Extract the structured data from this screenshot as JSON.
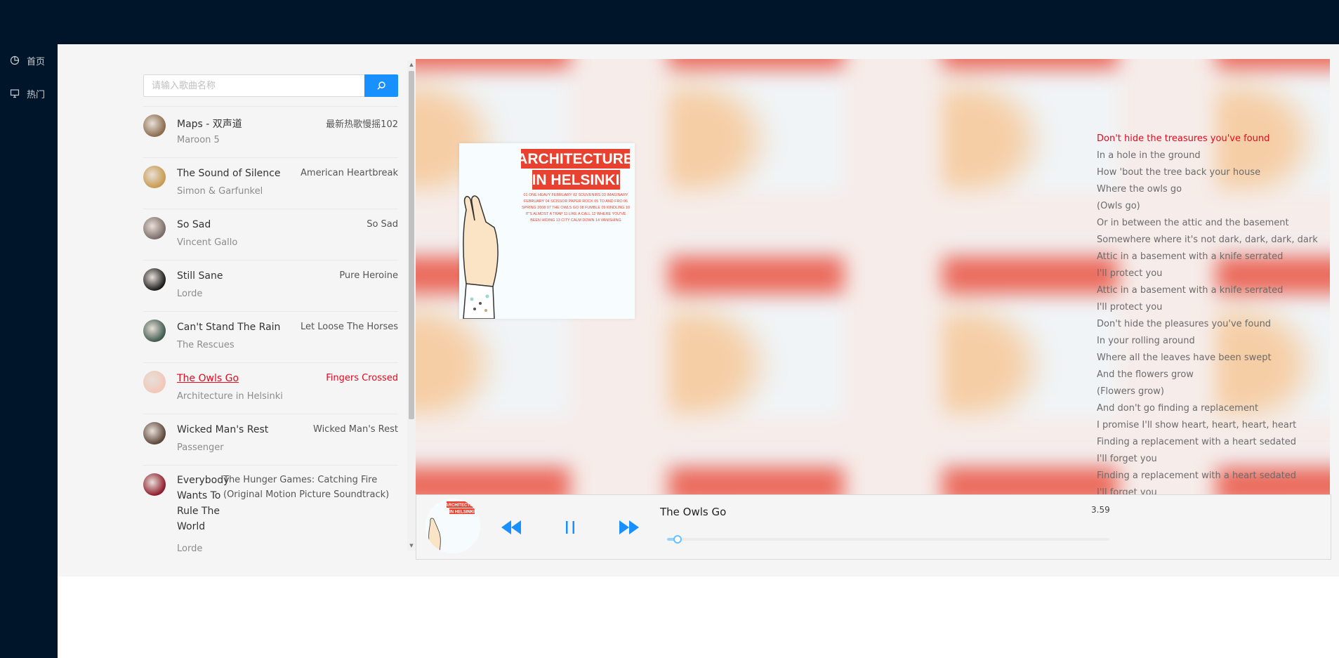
{
  "nav": {
    "home_label": "首页",
    "hot_label": "热门"
  },
  "search": {
    "placeholder": "请输入歌曲名称",
    "value": ""
  },
  "songs": [
    {
      "title": "Maps - 双声道",
      "artist": "Maroon 5",
      "album": "最新热歌慢摇102",
      "avatar_color": "#8a6a4a"
    },
    {
      "title": "The Sound of Silence",
      "artist": "Simon & Garfunkel",
      "album": "American Heartbreak",
      "avatar_color": "#c89a4c"
    },
    {
      "title": "So Sad",
      "artist": "Vincent Gallo",
      "album": "So Sad",
      "avatar_color": "#7a6b66"
    },
    {
      "title": "Still Sane",
      "artist": "Lorde",
      "album": "Pure Heroine",
      "avatar_color": "#1a1a1a"
    },
    {
      "title": "Can't Stand The Rain",
      "artist": "The Rescues",
      "album": "Let Loose The Horses",
      "avatar_color": "#3f5a4e"
    },
    {
      "title": "The Owls Go",
      "artist": "Architecture in Helsinki",
      "album": "Fingers Crossed",
      "avatar_color": "#f2c7b8"
    },
    {
      "title": "Wicked Man's Rest",
      "artist": "Passenger",
      "album": "Wicked Man's Rest",
      "avatar_color": "#5b4438"
    },
    {
      "title": "Everybody Wants To Rule The World",
      "artist": "Lorde",
      "album": "The Hunger Games: Catching Fire (Original Motion Picture Soundtrack)",
      "avatar_color": "#8e1b2b"
    }
  ],
  "active_song_index": 5,
  "cover_art": {
    "band_line1": "ARCHITECTURE",
    "band_line2": "IN HELSINKI",
    "tracklist": "01 ONE HEAVY FEBRUARY 02 SOUVENIRS 03 IMAGINARY FEBRUARY 04 SCISSOR PAPER ROCK 05 TO AND FRO 06 SPRING 2008 07 THE OWLS GO 08 FUMBLE 09 KINDLING 10 IT'S ALMOST A TRAP 11 LIKE A CALL 12 WHERE YOU'VE BEEN HIDING 13 CITY CALM DOWN 14 VANISHING",
    "accent_color": "#e8412f"
  },
  "lyrics": {
    "current_index": 0,
    "lines": [
      "Don't hide the treasures you've found",
      "In a hole in the ground",
      "How 'bout the tree back your house",
      "Where the owls go",
      "(Owls go)",
      "Or in between the attic and the basement",
      "Somewhere where it's not dark, dark, dark, dark",
      "Attic in a basement with a knife serrated",
      "I'll protect you",
      "Attic in a basement with a knife serrated",
      "I'll protect you",
      "Don't hide the pleasures you've found",
      "In your rolling around",
      "Where all the leaves have been swept",
      "And the flowers grow",
      "(Flowers grow)",
      "And don't go finding a replacement",
      "I promise I'll show heart, heart, heart, heart",
      "Finding a replacement with a heart sedated",
      "I'll forget you",
      "Finding a replacement with a heart sedated",
      "I'll forget you"
    ]
  },
  "player": {
    "now_playing_title": "The Owls Go",
    "time": "3.59",
    "progress_fraction": 0.015,
    "state": "playing"
  },
  "colors": {
    "nav_bg": "#001529",
    "accent": "#1890ff",
    "active_red": "#e5091e"
  },
  "icons": {
    "home": "pie-chart-icon",
    "hot": "desktop-icon",
    "search": "search-icon",
    "prev": "backward-icon",
    "pause": "pause-icon",
    "next": "forward-icon"
  }
}
